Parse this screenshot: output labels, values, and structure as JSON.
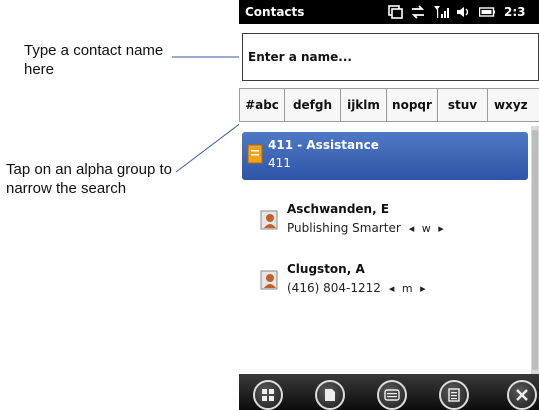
{
  "callouts": {
    "search_hint": "Type a contact name here",
    "alpha_hint": "Tap on an alpha group to narrow the search"
  },
  "status_bar": {
    "title": "Contacts",
    "time": "2:3",
    "icons": [
      "sync-icon",
      "connectivity-icon",
      "signal-icon",
      "speaker-icon",
      "battery-icon"
    ]
  },
  "search": {
    "placeholder": "Enter a name..."
  },
  "alpha_groups": [
    "#abc",
    "defgh",
    "ijklm",
    "nopqr",
    "stuv",
    "wxyz"
  ],
  "contacts": [
    {
      "name": "411 - Assistance",
      "detail": "411",
      "arrows": "",
      "selected": true
    },
    {
      "name": "Aschwanden, E",
      "detail": "Publishing Smarter",
      "arrows": "◂ w ▸",
      "selected": false
    },
    {
      "name": "Clugston, A",
      "detail": "(416) 804-1212",
      "arrows": "◂ m ▸",
      "selected": false
    }
  ],
  "bottom_bar": {
    "buttons": [
      "windows-start-icon",
      "new-contact-icon",
      "keyboard-icon",
      "menu-icon",
      "close-icon"
    ]
  },
  "colors": {
    "selection": "#2e55a6",
    "callout_line": "#2f5ea8",
    "status_bar": "#000000"
  }
}
